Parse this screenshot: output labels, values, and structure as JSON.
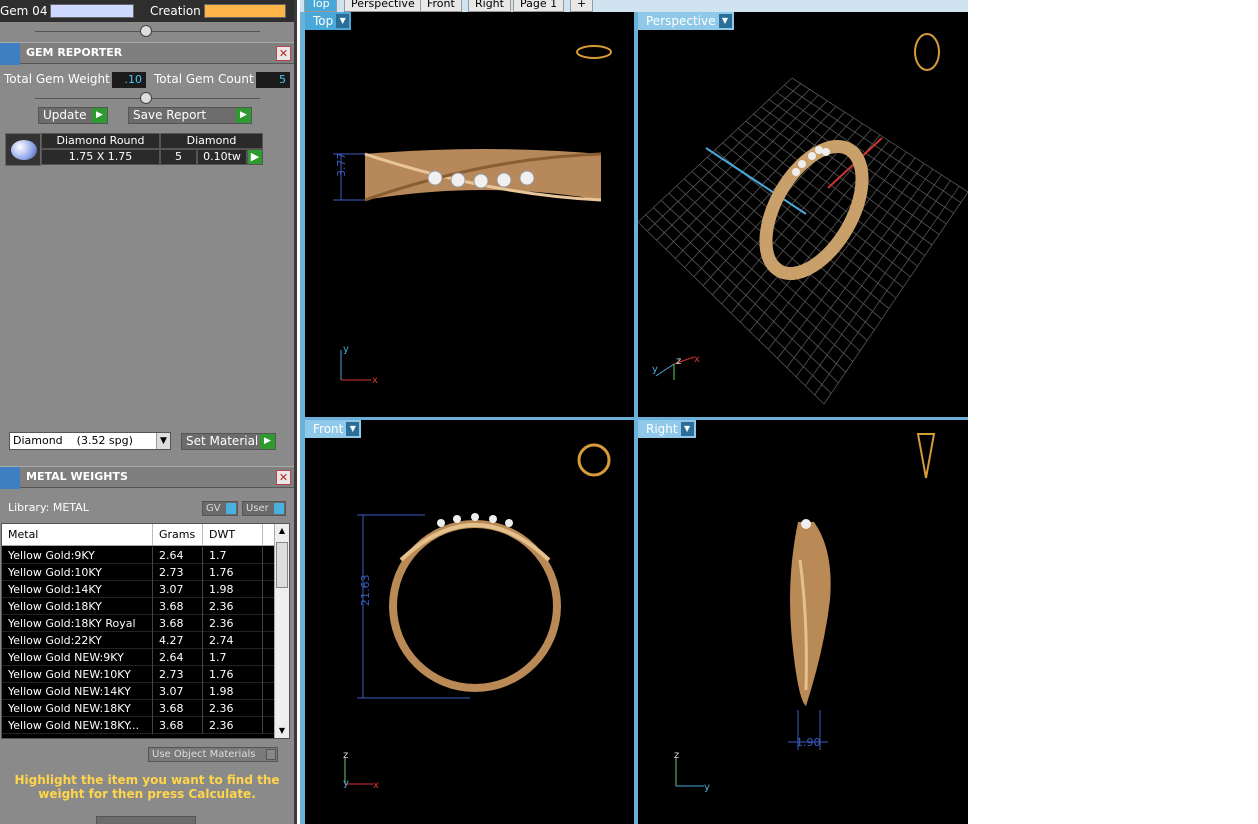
{
  "top_strip": {
    "left_label": "Gem 04",
    "right_label": "Creation"
  },
  "gem_reporter": {
    "title": "GEM REPORTER",
    "total_weight_label": "Total Gem Weight",
    "total_weight_value": ".10",
    "total_count_label": "Total Gem Count",
    "total_count_value": "5",
    "update_label": "Update",
    "save_report_label": "Save Report",
    "gem": {
      "shape": "Diamond Round",
      "material": "Diamond",
      "size": "1.75 X 1.75",
      "count": "5",
      "weight": "0.10tw"
    }
  },
  "material_select": {
    "value": "Diamond    (3.52 spg)",
    "set_label": "Set Material"
  },
  "metal_weights": {
    "title": "METAL WEIGHTS",
    "library_label": "Library: METAL",
    "gv_label": "GV",
    "user_label": "User",
    "columns": [
      "Metal",
      "Grams",
      "DWT"
    ],
    "rows": [
      [
        "Yellow Gold:9KY",
        "2.64",
        "1.7"
      ],
      [
        "Yellow Gold:10KY",
        "2.73",
        "1.76"
      ],
      [
        "Yellow Gold:14KY",
        "3.07",
        "1.98"
      ],
      [
        "Yellow Gold:18KY",
        "3.68",
        "2.36"
      ],
      [
        "Yellow Gold:18KY Royal",
        "3.68",
        "2.36"
      ],
      [
        "Yellow Gold:22KY",
        "4.27",
        "2.74"
      ],
      [
        "Yellow Gold NEW:9KY",
        "2.64",
        "1.7"
      ],
      [
        "Yellow Gold NEW:10KY",
        "2.73",
        "1.76"
      ],
      [
        "Yellow Gold NEW:14KY",
        "3.07",
        "1.98"
      ],
      [
        "Yellow Gold NEW:18KY",
        "3.68",
        "2.36"
      ],
      [
        "Yellow Gold NEW:18KY...",
        "3.68",
        "2.36"
      ]
    ],
    "use_object_materials": "Use Object Materials",
    "instruction": "Highlight the item you want to find the weight for then press Calculate."
  },
  "tabs": [
    "Top",
    "Perspective",
    "Front",
    "Right",
    "Page 1",
    "+"
  ],
  "viewports": {
    "top": {
      "label": "Top",
      "dim": "3.77"
    },
    "perspective": {
      "label": "Perspective"
    },
    "front": {
      "label": "Front",
      "dim": "21.63"
    },
    "right": {
      "label": "Right",
      "dim": "1.90"
    }
  },
  "colors": {
    "accent": "#4aa8d8",
    "gold": "#c9a06a",
    "dim": "#3b5bbf",
    "note": "#ffd54a"
  }
}
